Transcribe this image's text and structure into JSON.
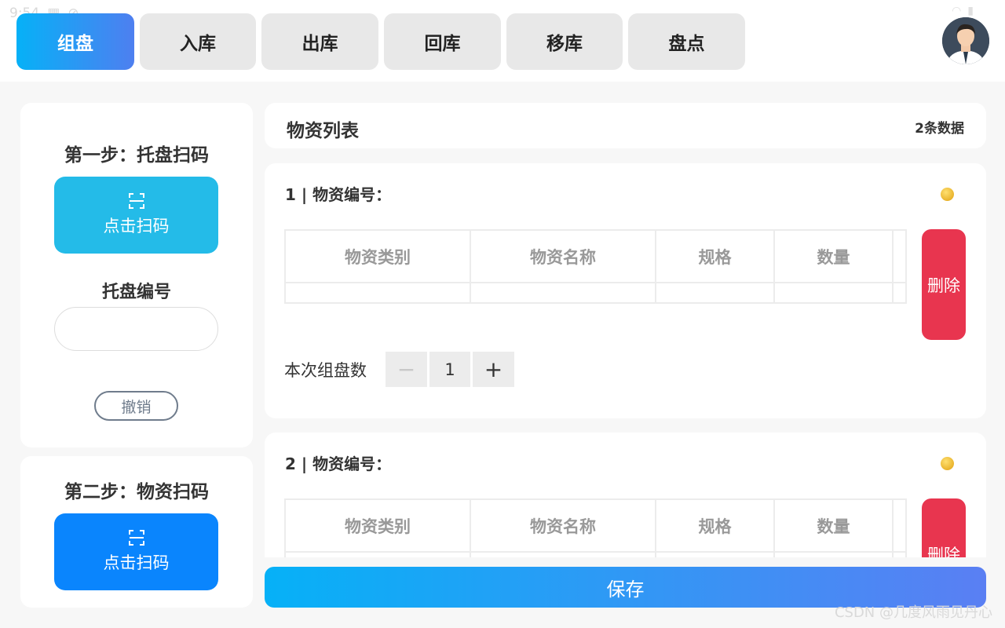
{
  "status": {
    "time": "9:54"
  },
  "tabs": [
    {
      "label": "组盘",
      "active": true
    },
    {
      "label": "入库"
    },
    {
      "label": "出库"
    },
    {
      "label": "回库"
    },
    {
      "label": "移库"
    },
    {
      "label": "盘点"
    }
  ],
  "step1": {
    "title": "第一步：托盘扫码",
    "scan_label": "点击扫码",
    "pallet_label": "托盘编号",
    "pallet_value": "",
    "undo_label": "撤销"
  },
  "step2": {
    "title": "第二步：物资扫码",
    "scan_label": "点击扫码"
  },
  "list": {
    "title": "物资列表",
    "count": "2条数据"
  },
  "columns": [
    "物资类别",
    "物资名称",
    "规格",
    "数量"
  ],
  "items": [
    {
      "heading": "1 | 物资编号：",
      "delete_label": "删除",
      "qty_label": "本次组盘数",
      "qty": "1",
      "minus": "−",
      "plus": "+"
    },
    {
      "heading": "2 | 物资编号：",
      "delete_label": "删除"
    }
  ],
  "save_label": "保存",
  "watermark": "CSDN @几度风雨见丹心",
  "colors": {
    "accent": "#06b1f7",
    "step1_scan": "#24bbe8",
    "step2_scan": "#0a85fd",
    "danger": "#e8354f"
  }
}
